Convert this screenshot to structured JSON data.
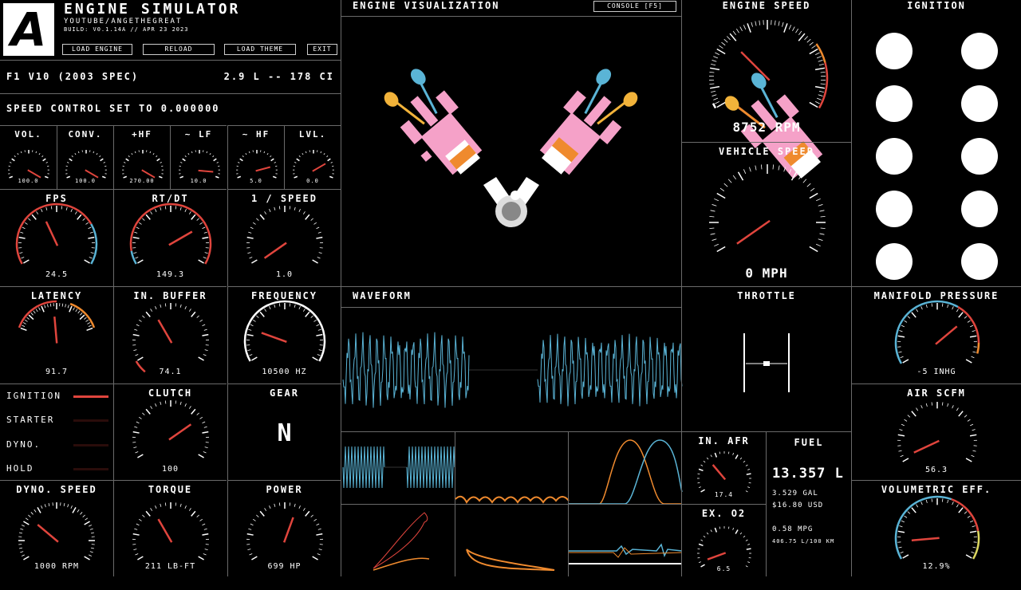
{
  "app": {
    "logo": "A",
    "title": "ENGINE SIMULATOR",
    "subtitle": "YOUTUBE/ANGETHEGREAT",
    "build": "BUILD: V0.1.14A // APR 23 2023"
  },
  "toolbar": {
    "load_engine": "LOAD ENGINE",
    "reload": "RELOAD",
    "load_theme": "LOAD THEME",
    "exit": "EXIT"
  },
  "engine": {
    "name": "F1 V10 (2003 SPEC)",
    "displacement": "2.9 L -- 178 CI"
  },
  "speed_control": "SPEED CONTROL SET TO 0.000000",
  "mini_gauges": [
    {
      "label": "VOL.",
      "value": "100.0"
    },
    {
      "label": "CONV.",
      "value": "100.0"
    },
    {
      "label": "+HF",
      "value": "270.00"
    },
    {
      "label": "~ LF",
      "value": "10.0"
    },
    {
      "label": "~ HF",
      "value": "5.0"
    },
    {
      "label": "LVL.",
      "value": "0.0"
    }
  ],
  "gauges": {
    "fps": {
      "label": "FPS",
      "value": "24.5"
    },
    "rtdt": {
      "label": "RT/DT",
      "value": "149.3"
    },
    "inv_speed": {
      "label": "1 / SPEED",
      "value": "1.0"
    },
    "latency": {
      "label": "LATENCY",
      "value": "91.7"
    },
    "in_buffer": {
      "label": "IN. BUFFER",
      "value": "74.1"
    },
    "frequency": {
      "label": "FREQUENCY",
      "value": "10500 HZ"
    },
    "clutch": {
      "label": "CLUTCH",
      "value": "100"
    },
    "dyno_speed": {
      "label": "DYNO. SPEED",
      "value": "1000 RPM"
    },
    "torque": {
      "label": "TORQUE",
      "value": "211 LB-FT"
    },
    "power": {
      "label": "POWER",
      "value": "699 HP"
    },
    "engine_speed": {
      "label": "ENGINE SPEED",
      "value": "8752 RPM"
    },
    "vehicle_speed": {
      "label": "VEHICLE SPEED",
      "value": "0 MPH"
    },
    "manifold": {
      "label": "MANIFOLD PRESSURE",
      "value": "-5 INHG"
    },
    "air_scfm": {
      "label": "AIR SCFM",
      "value": "56.3"
    },
    "vol_eff": {
      "label": "VOLUMETRIC EFF.",
      "value": "12.9%"
    },
    "in_afr": {
      "label": "IN. AFR",
      "value": "17.4"
    },
    "ex_o2": {
      "label": "EX. O2",
      "value": "6.5"
    }
  },
  "status": {
    "ignition": "IGNITION",
    "starter": "STARTER",
    "dyno": "DYNO.",
    "hold": "HOLD"
  },
  "gear": {
    "label": "GEAR",
    "value": "N"
  },
  "visualization": {
    "title": "ENGINE VISUALIZATION",
    "console_button": "CONSOLE [F5]"
  },
  "waveform": {
    "title": "WAVEFORM"
  },
  "throttle": {
    "title": "THROTTLE"
  },
  "ignition_panel": {
    "title": "IGNITION"
  },
  "fuel": {
    "title": "FUEL",
    "liters": "13.357 L",
    "gallons": "3.529 GAL",
    "cost": "$16.80 USD",
    "mpg": "0.58 MPG",
    "l100km": "406.75 L/100 KM"
  },
  "colors": {
    "accent_red": "#e0453d",
    "accent_blue": "#5ab4d6",
    "accent_orange": "#ef8a2e"
  }
}
